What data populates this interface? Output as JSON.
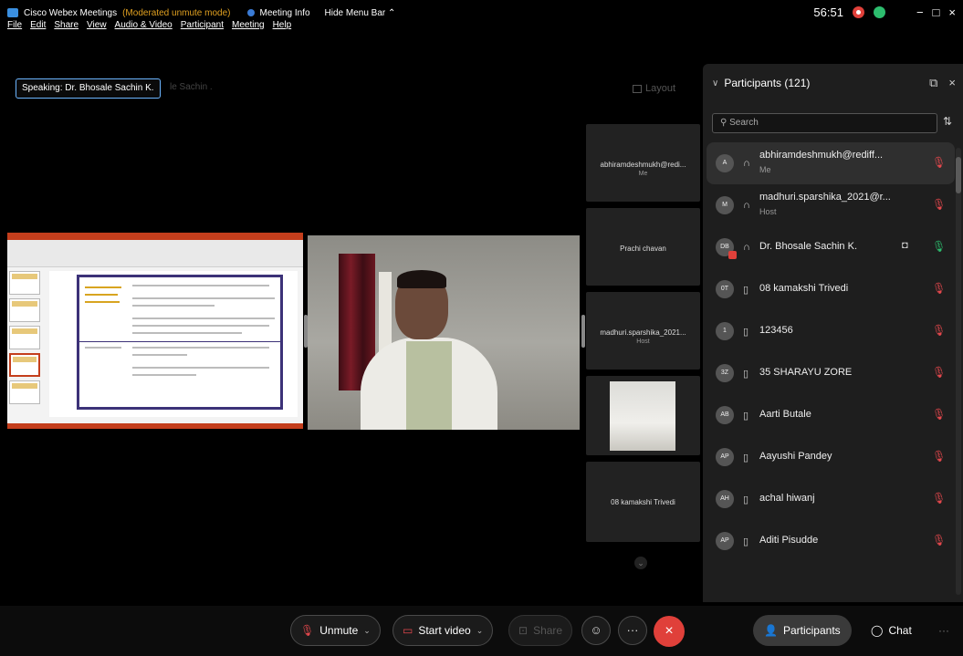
{
  "titlebar": {
    "app_title": "Cisco Webex Meetings",
    "mode": "(Moderated unmute mode)",
    "meeting_info": "Meeting Info",
    "hide_menu": "Hide Menu Bar",
    "hide_menu_icon": "chevron-up-icon",
    "timer": "56:51",
    "minimize": "−",
    "restore": "□",
    "close": "×"
  },
  "menu": [
    "File",
    "Edit",
    "Share",
    "View",
    "Audio & Video",
    "Participant",
    "Meeting",
    "Help"
  ],
  "speaking": {
    "label": "Speaking: Dr. Bhosale Sachin K.",
    "ghost": "le Sachin ."
  },
  "layout_label": "Layout",
  "strip": [
    {
      "name": "abhiramdeshmukh@redi...",
      "sub": "Me"
    },
    {
      "name": "Prachi chavan",
      "sub": ""
    },
    {
      "name": "madhuri.sparshika_2021...",
      "sub": "Host"
    },
    {
      "name": "",
      "sub": ""
    },
    {
      "name": "08 kamakshi Trivedi",
      "sub": ""
    }
  ],
  "strip_down_icon": "chevron-down-icon",
  "panel": {
    "title": "Participants (121)",
    "popout_icon": "popout-icon",
    "close_icon": "close-icon",
    "search_placeholder": "Search",
    "sort_icon": "sort-icon",
    "participants": [
      {
        "initials": "A",
        "name": "abhiramdeshmukh@rediff...",
        "role": "Me",
        "status": "headset",
        "mic": "muted",
        "selected": true
      },
      {
        "initials": "M",
        "name": "madhuri.sparshika_2021@r...",
        "role": "Host",
        "status": "headset",
        "mic": "muted"
      },
      {
        "initials": "DB",
        "name": "Dr. Bhosale Sachin K.",
        "role": "",
        "status": "headset",
        "mic": "unmuted",
        "sharing": true
      },
      {
        "initials": "0T",
        "name": "08 kamakshi Trivedi",
        "role": "",
        "status": "device",
        "mic": "muted"
      },
      {
        "initials": "1",
        "name": "123456",
        "role": "",
        "status": "device",
        "mic": "muted"
      },
      {
        "initials": "3Z",
        "name": "35 SHARAYU ZORE",
        "role": "",
        "status": "device",
        "mic": "muted"
      },
      {
        "initials": "AB",
        "name": "Aarti Butale",
        "role": "",
        "status": "device",
        "mic": "muted"
      },
      {
        "initials": "AP",
        "name": "Aayushi Pandey",
        "role": "",
        "status": "device",
        "mic": "muted"
      },
      {
        "initials": "AH",
        "name": "achal hiwanj",
        "role": "",
        "status": "device",
        "mic": "muted"
      },
      {
        "initials": "AP",
        "name": "Aditi Pisudde",
        "role": "",
        "status": "device",
        "mic": "muted"
      }
    ]
  },
  "toolbar": {
    "unmute": "Unmute",
    "start_video": "Start video",
    "share": "Share",
    "reactions_icon": "smiley-icon",
    "more": "···",
    "leave_icon": "close-icon",
    "participants": "Participants",
    "chat": "Chat",
    "overflow": "···"
  },
  "colors": {
    "accent_blue": "#6cb5ff",
    "recording_red": "#e0403a",
    "connected_green": "#2dbd6e",
    "mute_red": "#e5484d"
  }
}
